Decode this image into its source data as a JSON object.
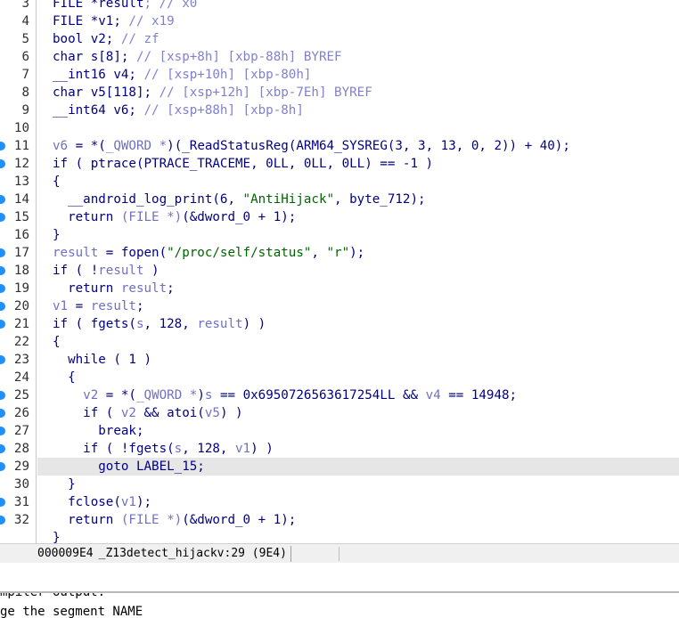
{
  "code_lines": [
    {
      "num": "3",
      "bp": false,
      "hl": false,
      "tokens": [
        [
          "FILE *",
          "id"
        ],
        [
          "result",
          "id"
        ],
        [
          "; // x0",
          "cmt"
        ]
      ]
    },
    {
      "num": "4",
      "bp": false,
      "hl": false,
      "tokens": [
        [
          "FILE *v1; ",
          "id"
        ],
        [
          "// x19",
          "cmt"
        ]
      ]
    },
    {
      "num": "5",
      "bp": false,
      "hl": false,
      "tokens": [
        [
          "bool v2; ",
          "id"
        ],
        [
          "// zf",
          "cmt"
        ]
      ]
    },
    {
      "num": "6",
      "bp": false,
      "hl": false,
      "tokens": [
        [
          "char s[8]; ",
          "id"
        ],
        [
          "// [xsp+8h] [xbp-88h] BYREF",
          "cmt"
        ]
      ]
    },
    {
      "num": "7",
      "bp": false,
      "hl": false,
      "tokens": [
        [
          "__int16 v4; ",
          "id"
        ],
        [
          "// [xsp+10h] [xbp-80h]",
          "cmt"
        ]
      ]
    },
    {
      "num": "8",
      "bp": false,
      "hl": false,
      "tokens": [
        [
          "char v5[118]; ",
          "id"
        ],
        [
          "// [xsp+12h] [xbp-7Eh] BYREF",
          "cmt"
        ]
      ]
    },
    {
      "num": "9",
      "bp": false,
      "hl": false,
      "tokens": [
        [
          "__int64 v6; ",
          "id"
        ],
        [
          "// [xsp+88h] [xbp-8h]",
          "cmt"
        ]
      ]
    },
    {
      "num": "10",
      "bp": false,
      "hl": false,
      "tokens": []
    },
    {
      "num": "11",
      "bp": true,
      "hl": false,
      "tokens": [
        [
          "v6",
          "var"
        ],
        [
          " = *(",
          "id"
        ],
        [
          "_QWORD *",
          "var"
        ],
        [
          ")(_ReadStatusReg(ARM64_SYSREG(3, 3, 13, 0, 2)) + 40);",
          "id"
        ]
      ]
    },
    {
      "num": "12",
      "bp": true,
      "hl": false,
      "tokens": [
        [
          "if ( ptrace(PTRACE_TRACEME, 0LL, 0LL, 0LL) == -1 )",
          "id"
        ]
      ]
    },
    {
      "num": "13",
      "bp": false,
      "hl": false,
      "tokens": [
        [
          "{",
          "id"
        ]
      ]
    },
    {
      "num": "14",
      "bp": true,
      "hl": false,
      "tokens": [
        [
          "  __android_log_print(6, ",
          "id"
        ],
        [
          "\"AntiHijack\"",
          "str"
        ],
        [
          ", byte_712);",
          "id"
        ]
      ]
    },
    {
      "num": "15",
      "bp": true,
      "hl": false,
      "tokens": [
        [
          "  return ",
          "id"
        ],
        [
          "(FILE *)",
          "var"
        ],
        [
          "(&dword_0 + 1);",
          "id"
        ]
      ]
    },
    {
      "num": "16",
      "bp": false,
      "hl": false,
      "tokens": [
        [
          "}",
          "id"
        ]
      ]
    },
    {
      "num": "17",
      "bp": true,
      "hl": false,
      "tokens": [
        [
          "result",
          "var"
        ],
        [
          " = fopen(",
          "id"
        ],
        [
          "\"/proc/self/status\"",
          "str"
        ],
        [
          ", ",
          "id"
        ],
        [
          "\"r\"",
          "str"
        ],
        [
          ");",
          "id"
        ]
      ]
    },
    {
      "num": "18",
      "bp": true,
      "hl": false,
      "tokens": [
        [
          "if ( !",
          "id"
        ],
        [
          "result",
          "var"
        ],
        [
          " )",
          "id"
        ]
      ]
    },
    {
      "num": "19",
      "bp": true,
      "hl": false,
      "tokens": [
        [
          "  return ",
          "id"
        ],
        [
          "result",
          "var"
        ],
        [
          ";",
          "id"
        ]
      ]
    },
    {
      "num": "20",
      "bp": true,
      "hl": false,
      "tokens": [
        [
          "v1",
          "var"
        ],
        [
          " = ",
          "id"
        ],
        [
          "result",
          "var"
        ],
        [
          ";",
          "id"
        ]
      ]
    },
    {
      "num": "21",
      "bp": true,
      "hl": false,
      "tokens": [
        [
          "if ( fgets(",
          "id"
        ],
        [
          "s",
          "var"
        ],
        [
          ", 128, ",
          "id"
        ],
        [
          "result",
          "var"
        ],
        [
          ") )",
          "id"
        ]
      ]
    },
    {
      "num": "22",
      "bp": false,
      "hl": false,
      "tokens": [
        [
          "{",
          "id"
        ]
      ]
    },
    {
      "num": "23",
      "bp": true,
      "hl": false,
      "tokens": [
        [
          "  while ( 1 )",
          "id"
        ]
      ]
    },
    {
      "num": "24",
      "bp": false,
      "hl": false,
      "tokens": [
        [
          "  {",
          "id"
        ]
      ]
    },
    {
      "num": "25",
      "bp": true,
      "hl": false,
      "tokens": [
        [
          "    ",
          "id"
        ],
        [
          "v2",
          "var"
        ],
        [
          " = *(",
          "id"
        ],
        [
          "_QWORD *",
          "var"
        ],
        [
          ")",
          "id"
        ],
        [
          "s",
          "var"
        ],
        [
          " == 0x6950726563617254LL && ",
          "id"
        ],
        [
          "v4",
          "var"
        ],
        [
          " == 14948;",
          "id"
        ]
      ]
    },
    {
      "num": "26",
      "bp": true,
      "hl": false,
      "tokens": [
        [
          "    if ( ",
          "id"
        ],
        [
          "v2",
          "var"
        ],
        [
          " && atoi(",
          "id"
        ],
        [
          "v5",
          "var"
        ],
        [
          ") )",
          "id"
        ]
      ]
    },
    {
      "num": "27",
      "bp": true,
      "hl": false,
      "tokens": [
        [
          "      break;",
          "id"
        ]
      ]
    },
    {
      "num": "28",
      "bp": true,
      "hl": false,
      "tokens": [
        [
          "    if ( !fgets(",
          "id"
        ],
        [
          "s",
          "var"
        ],
        [
          ", 128, ",
          "id"
        ],
        [
          "v1",
          "var"
        ],
        [
          ") )",
          "id"
        ]
      ]
    },
    {
      "num": "29",
      "bp": true,
      "hl": true,
      "tokens": [
        [
          "      goto LABEL_15;",
          "id"
        ]
      ]
    },
    {
      "num": "30",
      "bp": false,
      "hl": false,
      "tokens": [
        [
          "  }",
          "id"
        ]
      ]
    },
    {
      "num": "31",
      "bp": true,
      "hl": false,
      "tokens": [
        [
          "  fclose(",
          "id"
        ],
        [
          "v1",
          "var"
        ],
        [
          ");",
          "id"
        ]
      ]
    },
    {
      "num": "32",
      "bp": true,
      "hl": false,
      "tokens": [
        [
          "  return ",
          "id"
        ],
        [
          "(FILE *)",
          "var"
        ],
        [
          "(&dword_0 + 1);",
          "id"
        ]
      ]
    },
    {
      "num": "",
      "bp": false,
      "hl": false,
      "tokens": [
        [
          "}",
          "id"
        ]
      ]
    }
  ],
  "status": {
    "address": "000009E4",
    "location": "_Z13detect_hijackv:29 (9E4)"
  },
  "output": {
    "line1": "mpiler output:",
    "line2": "ge the segment NAME"
  },
  "colors": {
    "breakpoint": "#1e90ff",
    "highlight": "#e6e6e6",
    "string": "#006400",
    "comment": "#8080d0",
    "variable": "#7070c0",
    "identifier": "#000080"
  }
}
